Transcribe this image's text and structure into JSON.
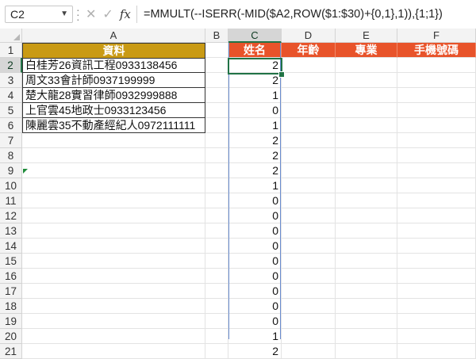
{
  "formula_bar": {
    "name_box": "C2",
    "fx_label": "fx",
    "formula": "=MMULT(--ISERR(-MID($A2,ROW($1:$30)+{0,1},1)),{1;1})"
  },
  "columns": [
    "A",
    "B",
    "C",
    "D",
    "E",
    "F"
  ],
  "rows": [
    "1",
    "2",
    "3",
    "4",
    "5",
    "6",
    "7",
    "8",
    "9",
    "10",
    "11",
    "12",
    "13",
    "14",
    "15",
    "16",
    "17",
    "18",
    "19",
    "20",
    "21"
  ],
  "header_row": {
    "a1": "資料",
    "c1": "姓名",
    "d1": "年齡",
    "e1": "專業",
    "f1": "手機號碼"
  },
  "data_column_a": [
    "白桂芳26資訊工程0933138456",
    "周文33會計師0937199999",
    "楚大龍28實習律師0932999888",
    "上官雲45地政士0933123456",
    "陳麗雲35不動產經紀人0972111111"
  ],
  "column_c_values": [
    "2",
    "2",
    "1",
    "0",
    "1",
    "2",
    "2",
    "2",
    "1",
    "0",
    "0",
    "0",
    "0",
    "0",
    "0",
    "0",
    "0",
    "0",
    "1",
    "2"
  ],
  "colors": {
    "header_gold": "#c99a14",
    "header_orange": "#e8532a",
    "selection_green": "#217346"
  }
}
